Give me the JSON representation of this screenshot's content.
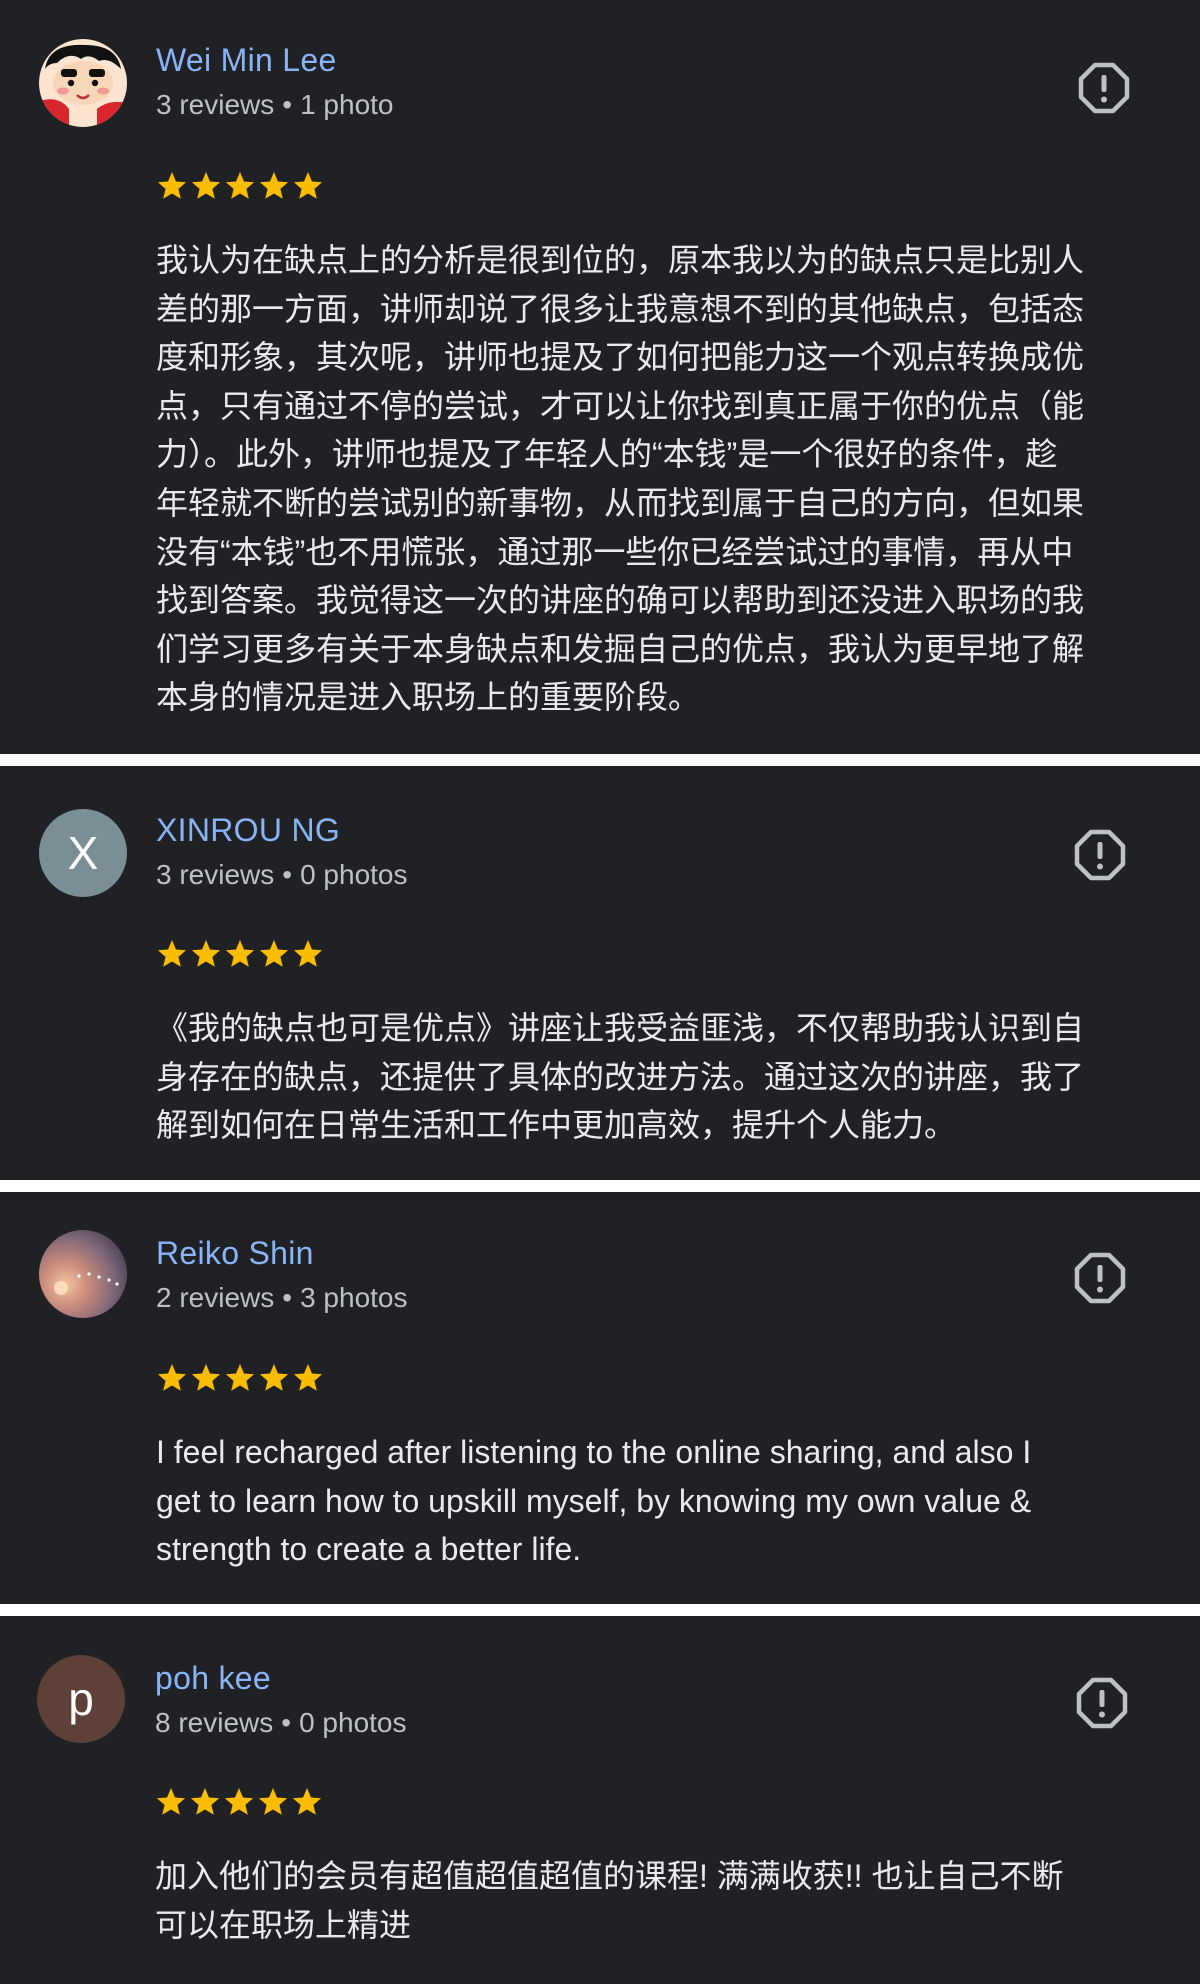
{
  "colors": {
    "background": "#202124",
    "separator": "#ffffff",
    "name": "#8ab4f8",
    "meta": "#bdc1c6",
    "body_text": "#e8eaed",
    "star": "#fbbc04"
  },
  "reviews": [
    {
      "reviewer": "Wei Min Lee",
      "reviews_count": "3 reviews",
      "photos_count": "1 photo",
      "avatar": "cartoon-avatar",
      "rating": 5,
      "text": "我认为在缺点上的分析是很到位的，原本我以为的缺点只是比别人\n差的那一方面，讲师却说了很多让我意想不到的其他缺点，包括态\n度和形象，其次呢，讲师也提及了如何把能力这一个观点转换成优\n点，只有通过不停的尝试，才可以让你找到真正属于你的优点（能\n力）。此外，讲师也提及了年轻人的“本钱”是一个很好的条件，趁\n年轻就不断的尝试别的新事物，从而找到属于自己的方向，但如果\n没有“本钱”也不用慌张，通过那一些你已经尝试过的事情，再从中\n找到答案。我觉得这一次的讲座的确可以帮助到还没进入职场的我\n们学习更多有关于本身缺点和发掘自己的优点，我认为更早地了解\n本身的情况是进入职场上的重要阶段。"
    },
    {
      "reviewer": "XINROU NG",
      "reviews_count": "3 reviews",
      "photos_count": "0 photos",
      "avatar_letter": "X",
      "avatar_color": "#7a8e96",
      "rating": 5,
      "text": "《我的缺点也可是优点》讲座让我受益匪浅，不仅帮助我认识到自\n身存在的缺点，还提供了具体的改进方法。通过这次的讲座，我了\n解到如何在日常生活和工作中更加高效，提升个人能力。"
    },
    {
      "reviewer": "Reiko Shin",
      "reviews_count": "2 reviews",
      "photos_count": "3 photos",
      "avatar": "photo-avatar",
      "rating": 5,
      "text": "I feel recharged after listening to the online sharing, and also I\nget to learn how to upskill myself, by knowing my own value &\nstrength to create a better life."
    },
    {
      "reviewer": "poh kee",
      "reviews_count": "8 reviews",
      "photos_count": "0 photos",
      "avatar_letter": "p",
      "avatar_color": "#5d4037",
      "rating": 5,
      "text": "加入他们的会员有超值超值超值的课程! 满满收获!! 也让自己不断\n可以在职场上精进"
    }
  ],
  "icons": {
    "flag": "report-flag-icon",
    "star": "star-icon"
  }
}
